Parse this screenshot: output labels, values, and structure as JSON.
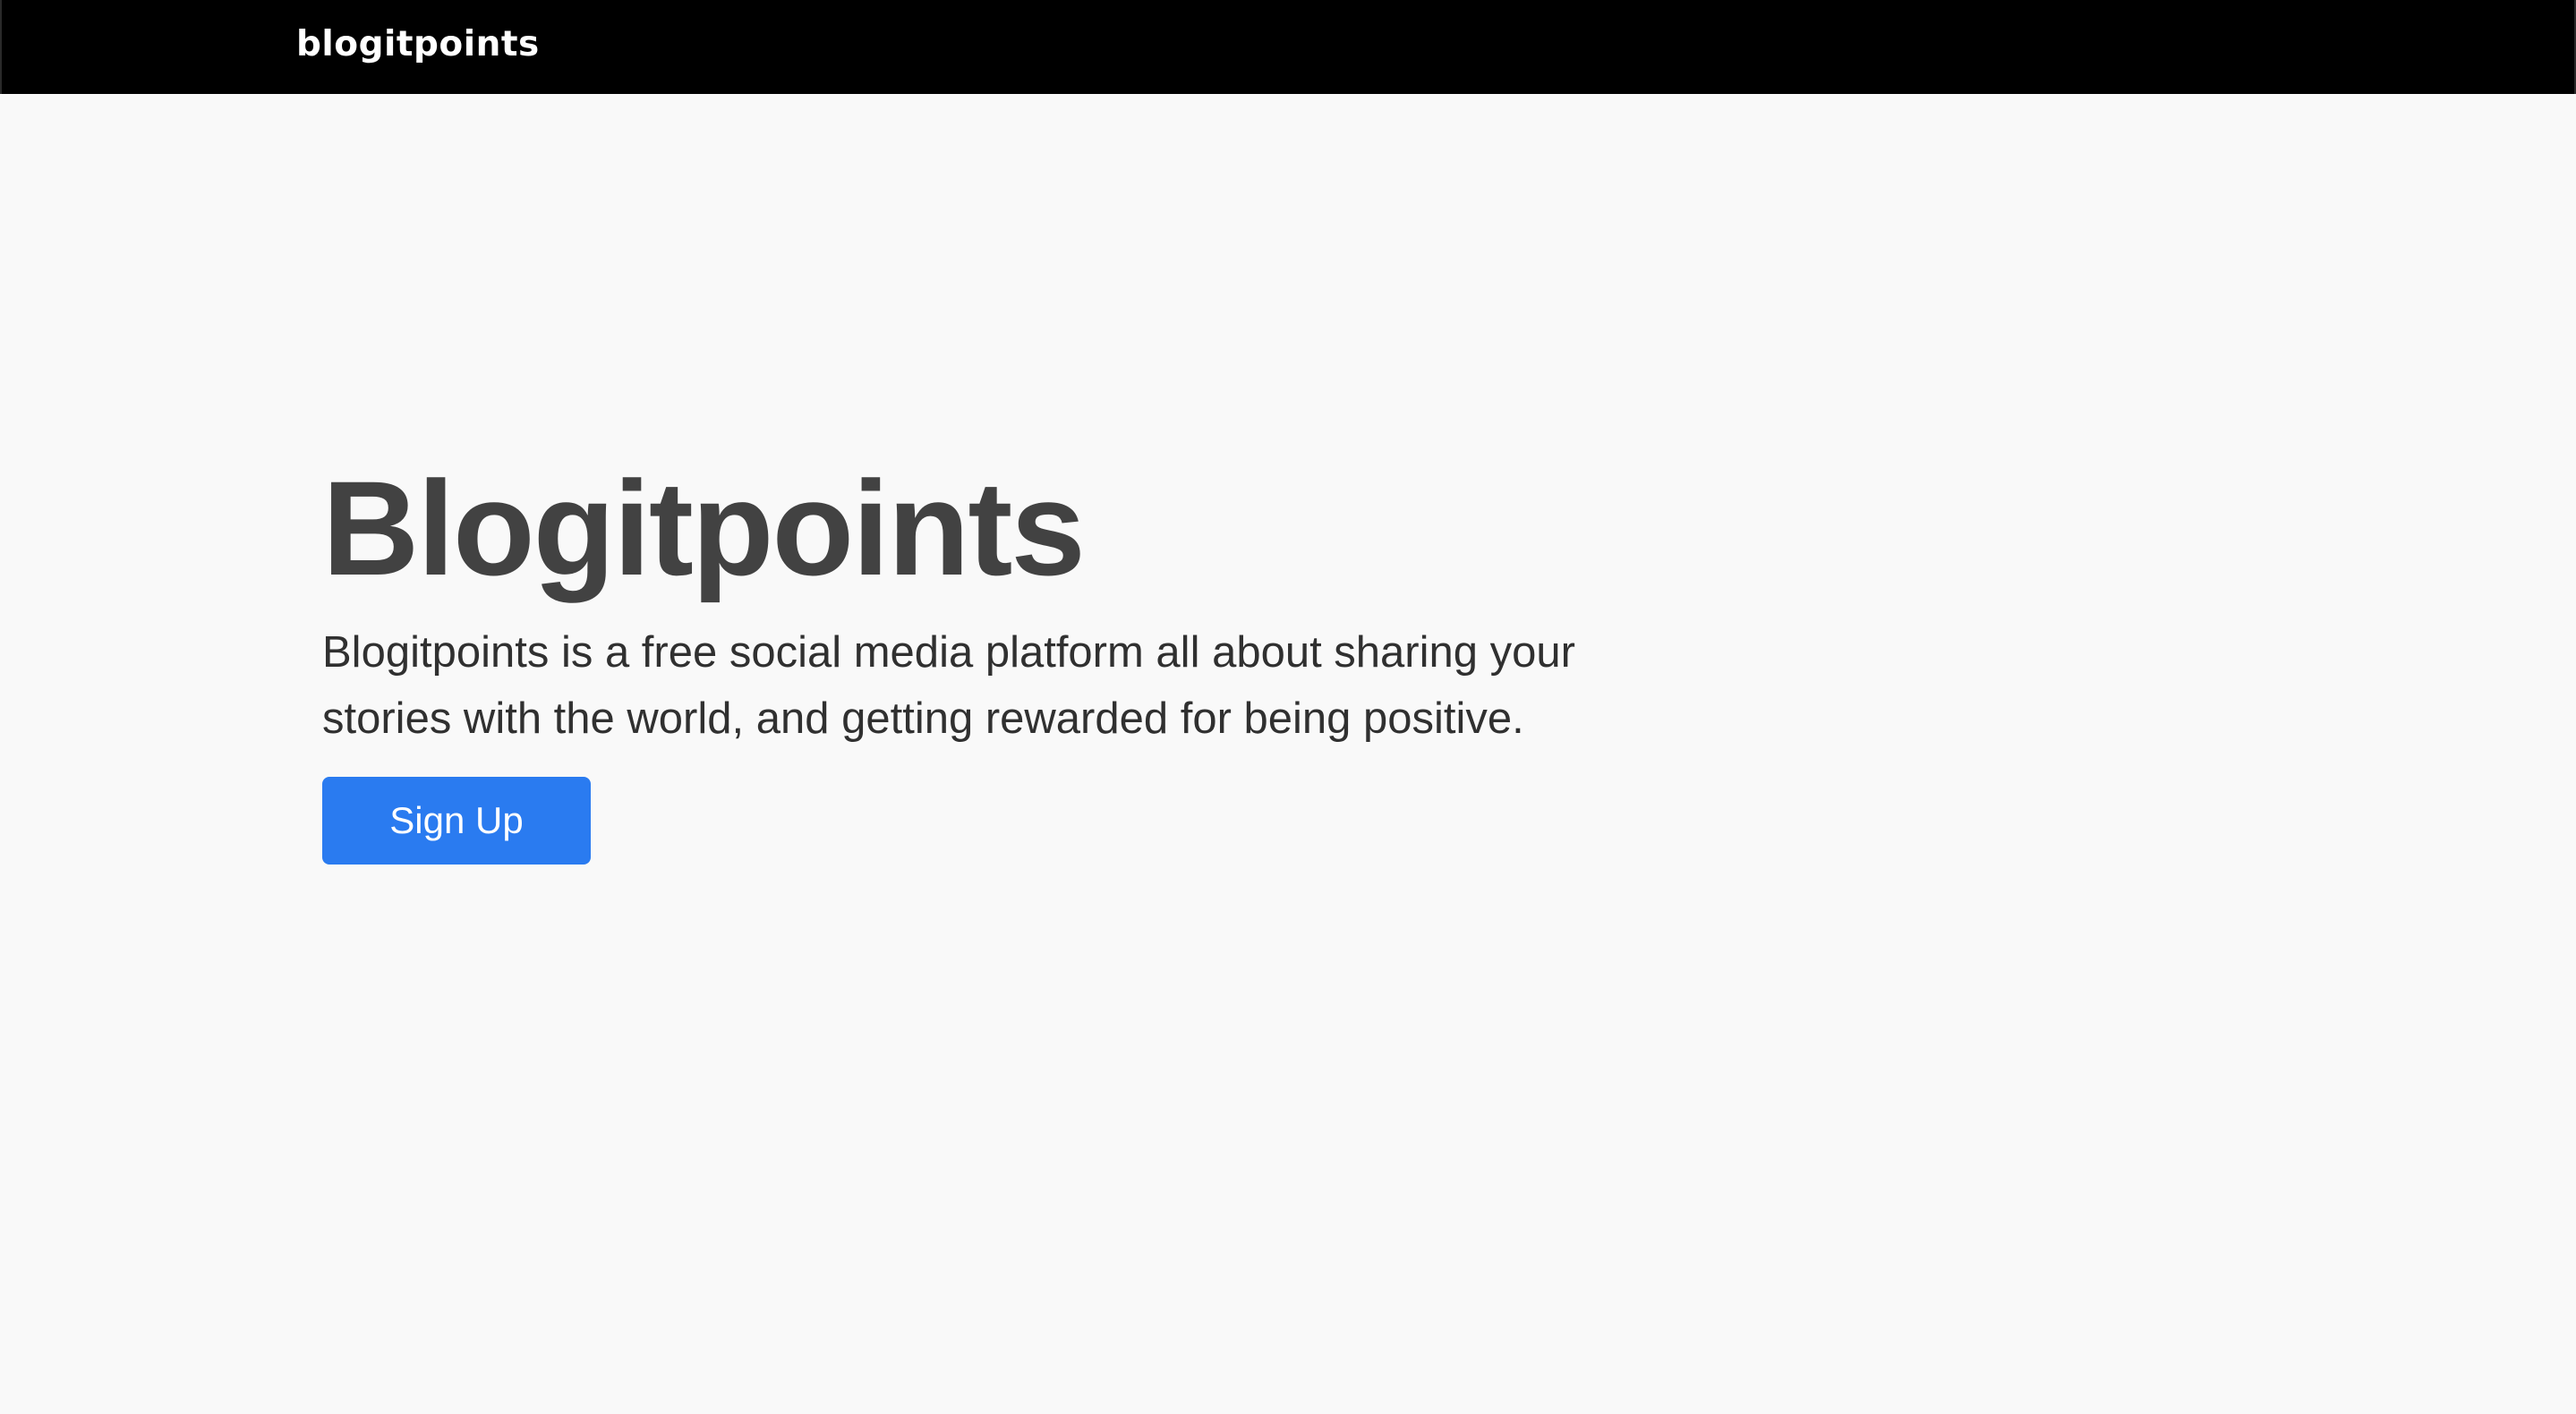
{
  "header": {
    "brand": "blogitpoints"
  },
  "hero": {
    "title": "Blogitpoints",
    "description": "Blogitpoints is a free social media platform all about sharing your stories with the world, and getting rewarded for being positive.",
    "signup_label": "Sign Up"
  },
  "colors": {
    "header_bg": "#000000",
    "page_bg": "#f9f9f9",
    "heading_text": "#424242",
    "body_text": "#303030",
    "accent": "#2a7bf0"
  }
}
